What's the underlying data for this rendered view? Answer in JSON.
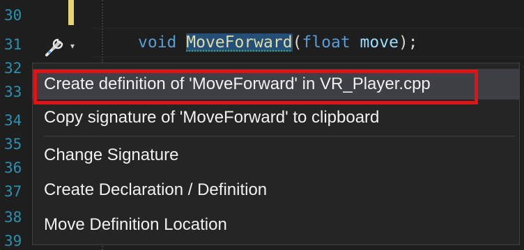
{
  "editor": {
    "line_numbers": [
      "30",
      "31",
      "32",
      "33",
      "34",
      "35",
      "36",
      "37",
      "38",
      "39"
    ],
    "code": {
      "keyword_void": "void",
      "function_name": "MoveForward",
      "open_paren": "(",
      "keyword_float": "float",
      "param_name": "move",
      "close": ");"
    },
    "trailing_semicolon": ";"
  },
  "quick_actions": {
    "icon": "screwdriver-icon",
    "caret": "▾"
  },
  "menu": {
    "items": [
      {
        "label": "Create definition of 'MoveForward' in VR_Player.cpp"
      },
      {
        "label": "Copy signature of 'MoveForward' to clipboard"
      },
      {
        "label": "Change Signature"
      },
      {
        "label": "Create Declaration / Definition"
      },
      {
        "label": "Move Definition Location"
      }
    ]
  },
  "colors": {
    "highlight_border": "#e01414",
    "line_number": "#2b91af",
    "keyword": "#569cd6"
  }
}
